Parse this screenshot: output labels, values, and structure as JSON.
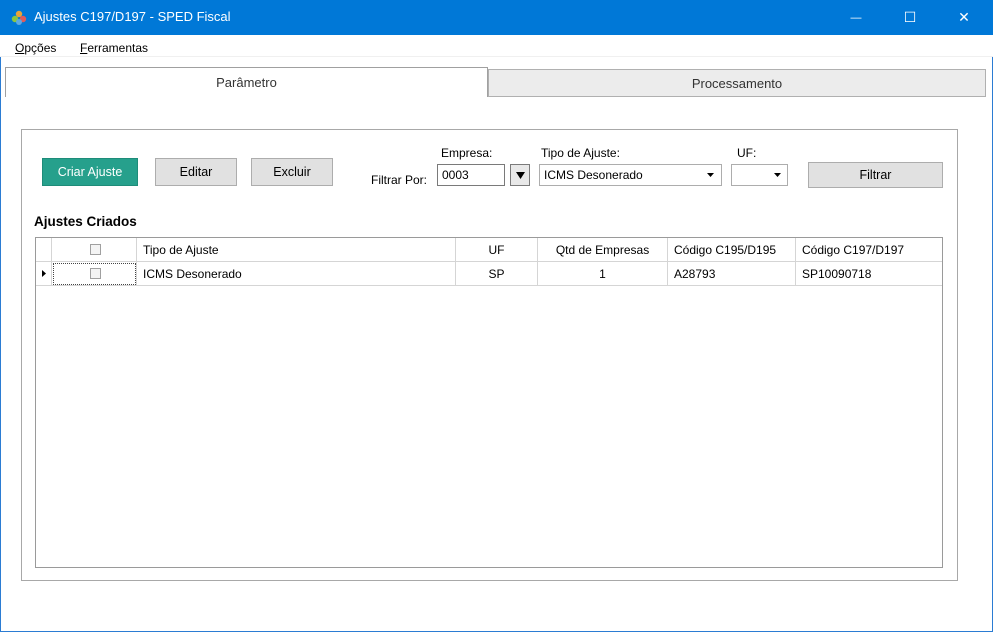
{
  "window": {
    "title": "Ajustes C197/D197 - SPED Fiscal",
    "minimize_symbol": "—",
    "maximize_symbol": "☐",
    "close_symbol": "✕"
  },
  "menu": {
    "items": [
      {
        "accel": "O",
        "rest": "pções"
      },
      {
        "accel": "F",
        "rest": "erramentas"
      }
    ]
  },
  "tabs": {
    "active": "Parâmetro",
    "inactive": "Processamento"
  },
  "toolbar": {
    "criar": "Criar Ajuste",
    "editar": "Editar",
    "excluir": "Excluir",
    "filtrar": "Filtrar",
    "filter_by_label": "Filtrar Por:"
  },
  "filters": {
    "empresa_label": "Empresa:",
    "empresa_value": "0003",
    "tipo_label": "Tipo de Ajuste:",
    "tipo_value": "ICMS Desonerado",
    "uf_label": "UF:",
    "uf_value": ""
  },
  "section_title": "Ajustes Criados",
  "grid": {
    "columns": [
      "Tipo de Ajuste",
      "UF",
      "Qtd de Empresas",
      "Código C195/D195",
      "Código C197/D197"
    ],
    "rows": [
      {
        "tipo": "ICMS Desonerado",
        "uf": "SP",
        "qtd": "1",
        "c195": "A28793",
        "c197": "SP10090718",
        "checked": false
      }
    ]
  },
  "colors": {
    "titlebar": "#0078d7",
    "accent_button": "#26a08c"
  }
}
